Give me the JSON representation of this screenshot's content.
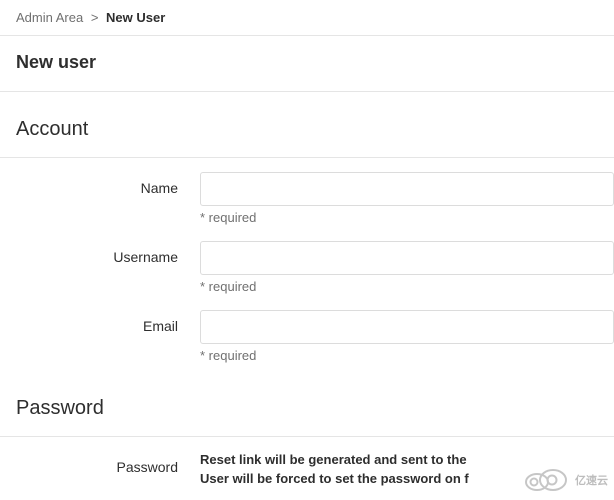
{
  "breadcrumb": {
    "root": "Admin Area",
    "current": "New User"
  },
  "page_title": "New user",
  "sections": {
    "account": {
      "title": "Account",
      "fields": {
        "name": {
          "label": "Name",
          "value": "",
          "hint": "* required"
        },
        "username": {
          "label": "Username",
          "value": "",
          "hint": "* required"
        },
        "email": {
          "label": "Email",
          "value": "",
          "hint": "* required"
        }
      }
    },
    "password": {
      "title": "Password",
      "fields": {
        "password": {
          "label": "Password",
          "hint_line1": "Reset link will be generated and sent to the",
          "hint_line2": "User will be forced to set the password on f"
        }
      }
    }
  },
  "watermark": "亿速云"
}
